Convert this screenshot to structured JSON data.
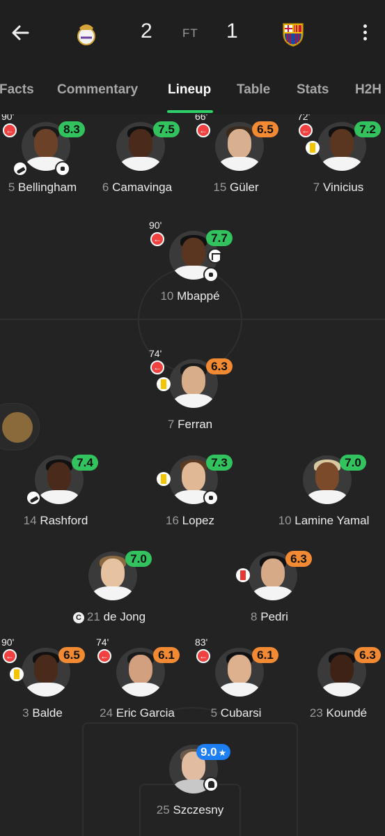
{
  "header": {
    "home_score": "2",
    "status": "FT",
    "away_score": "1"
  },
  "tabs": [
    "Facts",
    "Commentary",
    "Lineup",
    "Table",
    "Stats",
    "H2H"
  ],
  "active_tab": "Lineup",
  "colors": {
    "accent": "#2fcf6b",
    "rating_green": "#32c35f",
    "rating_orange": "#f28a33",
    "rating_blue": "#1e7ff5"
  },
  "players": [
    {
      "num": "5",
      "name": "Bellingham",
      "rating": "8.3",
      "minute": "90'"
    },
    {
      "num": "6",
      "name": "Camavinga",
      "rating": "7.5"
    },
    {
      "num": "15",
      "name": "Güler",
      "rating": "6.5",
      "minute": "66'"
    },
    {
      "num": "7",
      "name": "Vinicius",
      "rating": "7.2",
      "minute": "72'"
    },
    {
      "num": "10",
      "name": "Mbappé",
      "rating": "7.7",
      "minute": "90'"
    },
    {
      "num": "7",
      "name": "Ferran",
      "rating": "6.3",
      "minute": "74'"
    },
    {
      "num": "14",
      "name": "Rashford",
      "rating": "7.4"
    },
    {
      "num": "16",
      "name": "Lopez",
      "rating": "7.3"
    },
    {
      "num": "10",
      "name": "Lamine Yamal",
      "rating": "7.0"
    },
    {
      "num": "21",
      "name": "de Jong",
      "rating": "7.0",
      "captain": "C"
    },
    {
      "num": "8",
      "name": "Pedri",
      "rating": "6.3"
    },
    {
      "num": "3",
      "name": "Balde",
      "rating": "6.5",
      "minute": "90'"
    },
    {
      "num": "24",
      "name": "Eric Garcia",
      "rating": "6.1",
      "minute": "74'"
    },
    {
      "num": "5",
      "name": "Cubarsi",
      "rating": "6.1",
      "minute": "83'"
    },
    {
      "num": "23",
      "name": "Koundé",
      "rating": "6.3"
    },
    {
      "num": "25",
      "name": "Szczesny",
      "rating": "9.0",
      "star": "★"
    }
  ]
}
